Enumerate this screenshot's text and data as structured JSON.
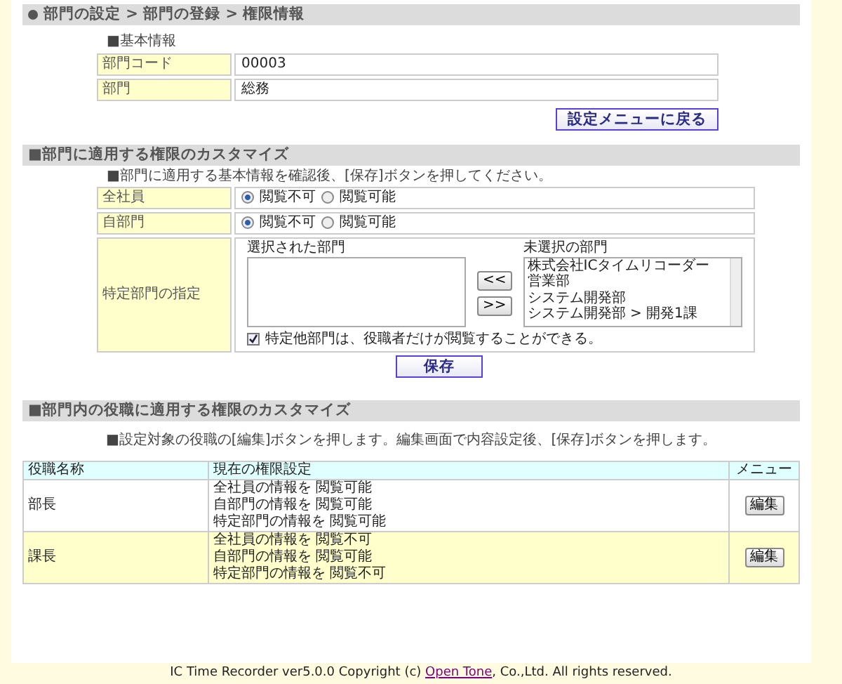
{
  "breadcrumb": "部門の設定 > 部門の登録 > 権限情報",
  "basic_info": {
    "heading": "■基本情報",
    "fields": [
      {
        "label": "部門コード",
        "value": "00003"
      },
      {
        "label": "部門",
        "value": "総務"
      }
    ]
  },
  "back_button": "設定メニューに戻る",
  "department_section": {
    "title": "■部門に適用する権限のカスタマイズ",
    "instruction": "■部門に適用する基本情報を確認後、[保存]ボタンを押してください。",
    "rows": [
      {
        "kind": "radio",
        "label": "全社員",
        "options": [
          {
            "label": "閲覧不可",
            "selected": true
          },
          {
            "label": "閲覧可能",
            "selected": false
          }
        ]
      },
      {
        "kind": "radio",
        "label": "自部門",
        "options": [
          {
            "label": "閲覧不可",
            "selected": true
          },
          {
            "label": "閲覧可能",
            "selected": false
          }
        ]
      },
      {
        "kind": "transfer",
        "label": "特定部門の指定",
        "selected_heading": "選択された部門",
        "unselected_heading": "未選択の部門",
        "add_button": "<<",
        "remove_button": ">>",
        "unselected_items": [
          "株式会社ICタイムリコーダー",
          "営業部",
          "システム開発部",
          "システム開発部 > 開発1課"
        ],
        "checkbox": {
          "label": "特定他部門は、役職者だけが閲覧することができる。",
          "checked": true
        }
      }
    ],
    "save_button": "保存"
  },
  "role_section": {
    "title": "■部門内の役職に適用する権限のカスタマイズ",
    "instruction": "■設定対象の役職の[編集]ボタンを押します。編集画面で内容設定後、[保存]ボタンを押します。",
    "columns": [
      "役職名称",
      "現在の権限設定",
      "メニュー"
    ],
    "rows": [
      {
        "name": "部長",
        "highlighted": false,
        "settings": [
          "全社員の情報を 閲覧可能",
          "自部門の情報を 閲覧可能",
          "特定部門の情報を 閲覧可能"
        ],
        "button": "編集"
      },
      {
        "name": "課長",
        "highlighted": true,
        "settings": [
          "全社員の情報を 閲覧不可",
          "自部門の情報を 閲覧可能",
          "特定部門の情報を 閲覧不可"
        ],
        "button": "編集"
      }
    ]
  },
  "footer": {
    "before": "IC Time Recorder ver5.0.0 Copyright (c) ",
    "link": "Open Tone",
    "after": ", Co.,Ltd. All rights reserved."
  }
}
